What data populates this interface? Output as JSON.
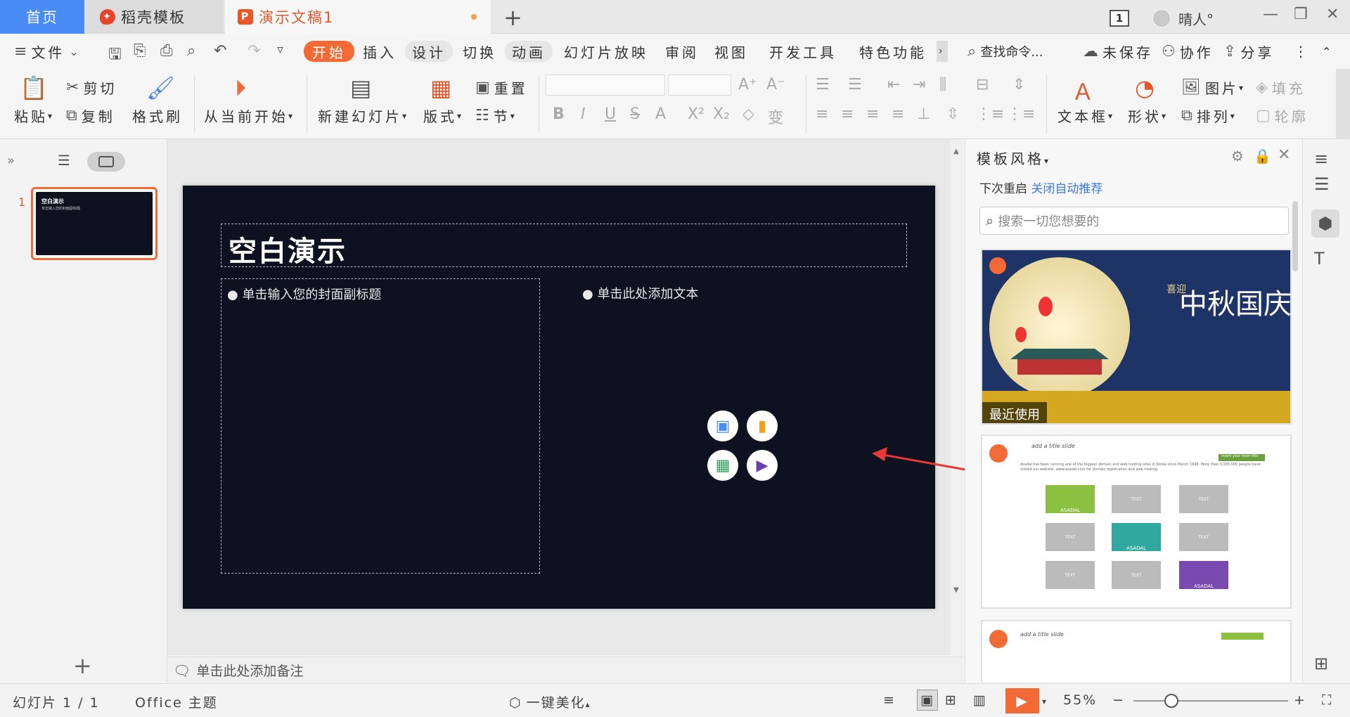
{
  "tabs": [
    {
      "label": "首页"
    },
    {
      "label": "稻壳模板"
    },
    {
      "label": "演示文稿1"
    }
  ],
  "window": {
    "badge": "1",
    "user": "晴人°"
  },
  "menu": {
    "file": "文件",
    "items": [
      "开始",
      "插入",
      "设计",
      "切换",
      "动画",
      "幻灯片放映",
      "审阅",
      "视图",
      "开发工具",
      "特色功能"
    ],
    "search": "查找命令...",
    "unsaved": "未保存",
    "collab": "协作",
    "share": "分享"
  },
  "ribbon": {
    "paste": "粘贴",
    "cut": "剪切",
    "copy": "复制",
    "format_painter": "格式刷",
    "from_start": "从当前开始",
    "new_slide": "新建幻灯片",
    "layout": "版式",
    "reset": "重置",
    "section": "节",
    "textbox": "文本框",
    "shape": "形状",
    "picture": "图片",
    "arrange": "排列",
    "fill": "填充",
    "outline": "轮廓"
  },
  "slides_panel": {
    "number": "1",
    "thumb_title": "空白演示",
    "thumb_sub": "单击输入您的封面副标题"
  },
  "slide": {
    "title": "空白演示",
    "subtitle_placeholder": "单击输入您的封面副标题",
    "content_placeholder": "单击此处添加文本"
  },
  "notes": {
    "placeholder": "单击此处添加备注"
  },
  "task_panel": {
    "title": "模板风格",
    "hint_prefix": "下次重启",
    "hint_link": "关闭自动推荐",
    "search_placeholder": "搜索一切您想要的",
    "recent_label": "最近使用",
    "tpl2_heading": "add a title slide",
    "tpl2_banner": "Insert your main title",
    "tpl2_text": "Asadal has been running one of the biggest domain and web hosting sites in Korea since March 1998. More than 3,000,000 people have visited our website, www.asadal.com for domain registration and web hosting.",
    "tpl2_box_a": "ASADAL",
    "tpl2_box_b": "TEXT",
    "tpl3_heading": "add a title slide",
    "autumn_title": "中秋国庆",
    "autumn_sub": "喜迎"
  },
  "statusbar": {
    "slide_pos": "幻灯片 1 / 1",
    "theme": "Office 主题",
    "beautify": "一键美化",
    "zoom": "55%"
  },
  "colors": {
    "accent": "#f26b36",
    "tab_home": "#4a8cf7",
    "slide_bg": "#0e1120"
  }
}
